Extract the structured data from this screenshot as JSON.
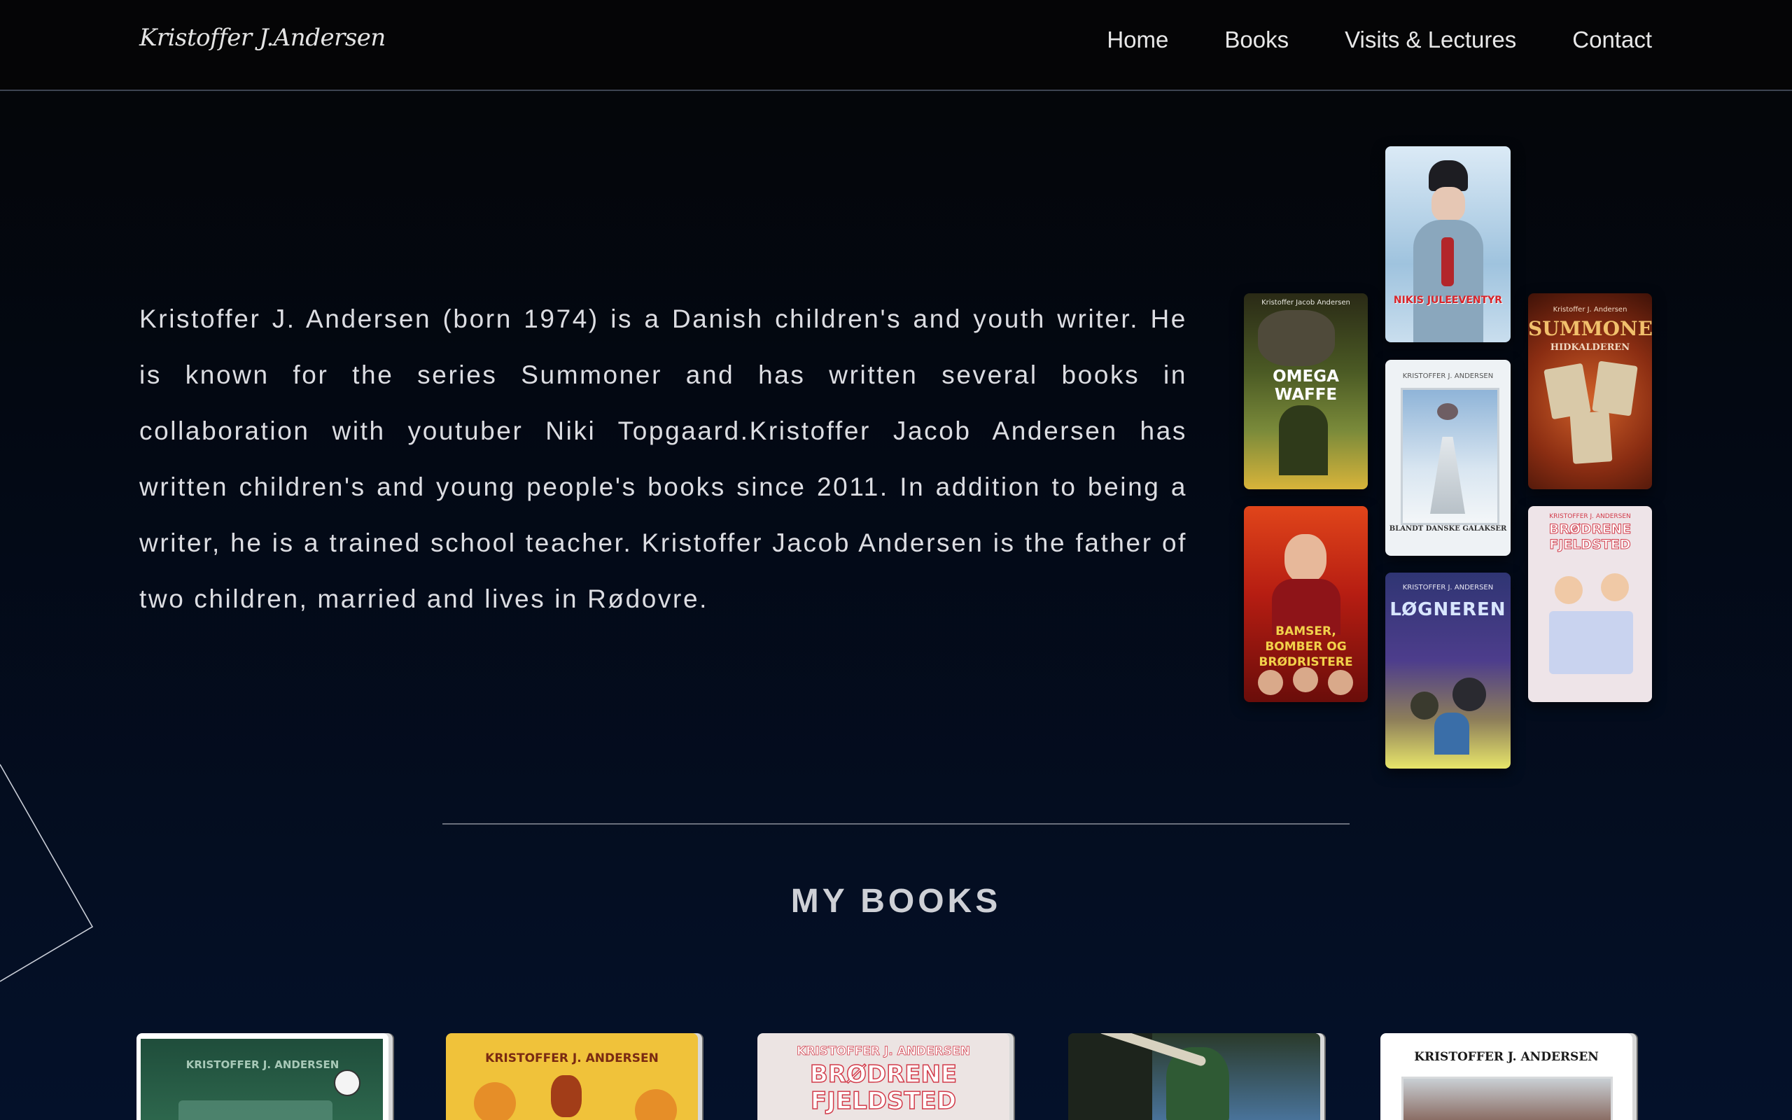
{
  "header": {
    "logo": "Kristoffer J.Andersen",
    "nav": [
      "Home",
      "Books",
      "Visits & Lectures",
      "Contact"
    ]
  },
  "bio": {
    "text": "Kristoffer J. Andersen (born 1974) is a Danish children's and youth writer. He is known for the series Summoner and has written several books in collaboration with youtuber Niki Topgaard.Kristoffer Jacob Andersen has written children's and young people's books since 2011. In addition to being a writer, he is a trained school teacher. Kristoffer Jacob Andersen is the father of two children, married and lives in Rødovre."
  },
  "collage": {
    "covers": [
      {
        "title": "NIKIS JULEEVENTYR",
        "author": "",
        "color": "#c7dff0"
      },
      {
        "title": "OMEGA WAFFE",
        "author": "Kristoffer Jacob Andersen",
        "color": "#5b6f2c"
      },
      {
        "title": "BLANDT DANSKE GALAKSER",
        "author": "KRISTOFFER J. ANDERSEN",
        "color": "#dfe7ee"
      },
      {
        "title": "SUMMONER",
        "subtitle": "HIDKALDEREN",
        "author": "Kristoffer J. Andersen",
        "color": "#7a2b12"
      },
      {
        "title": "BAMSER, BOMBER OG BRØDRISTERE",
        "author": "",
        "color": "#a9170f"
      },
      {
        "title": "LØGNEREN",
        "author": "KRISTOFFER J. ANDERSEN",
        "color": "#3c3b7a"
      },
      {
        "title": "BRØDRENE FJELDSTED",
        "author": "KRISTOFFER J. ANDERSEN",
        "color": "#e9dfe3"
      }
    ]
  },
  "books_section": {
    "title": "MY BOOKS",
    "books": [
      {
        "title": "",
        "author": "KRISTOFFER J. ANDERSEN"
      },
      {
        "title": "",
        "author": "KRISTOFFER J. ANDERSEN"
      },
      {
        "title": "BRØDRENE FJELDSTED",
        "author": "KRISTOFFER J. ANDERSEN"
      },
      {
        "title": "",
        "author": ""
      },
      {
        "title": "",
        "author": "KRISTOFFER J. ANDERSEN"
      }
    ]
  }
}
